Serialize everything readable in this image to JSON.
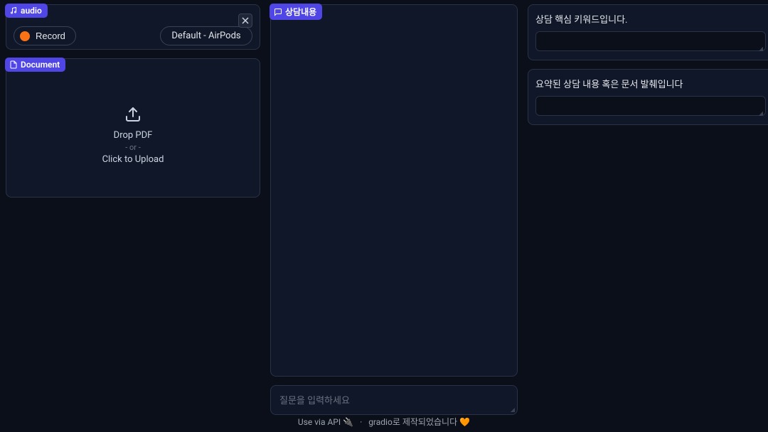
{
  "audio": {
    "pill": "audio",
    "record": "Record",
    "device": "Default - AirPods"
  },
  "document": {
    "pill": "Document",
    "drop_line": "Drop PDF",
    "or": "- or -",
    "click_line": "Click to Upload"
  },
  "chat": {
    "pill": "상담내용",
    "input_placeholder": "질문을 입력하세요"
  },
  "right": {
    "keywords_label": "상담 핵심 키워드입니다.",
    "summary_label": "요약된 상담 내용 혹은 문서 발췌입니다"
  },
  "footer": {
    "api": "Use via API",
    "api_emoji": "🔌",
    "sep": "·",
    "gradio": "gradio로 제작되었습니다",
    "gradio_emoji": "🧡"
  }
}
